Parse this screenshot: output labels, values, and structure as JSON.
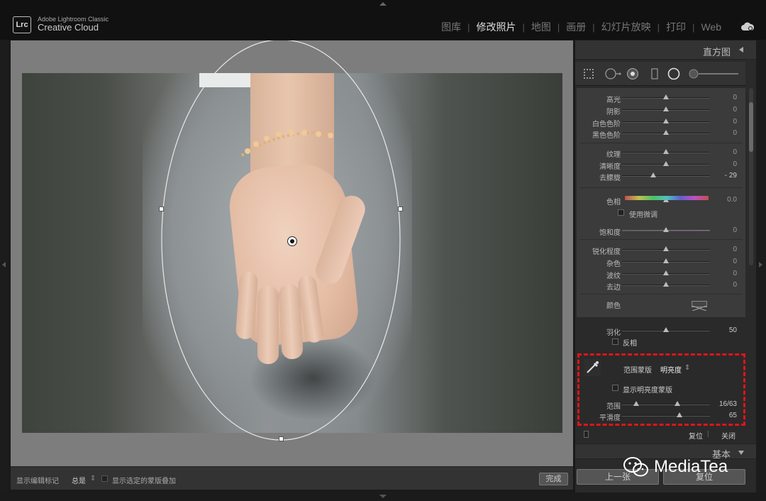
{
  "app": {
    "logo": "Lrc",
    "brand_line1": "Adobe Lightroom Classic",
    "brand_line2": "Creative Cloud"
  },
  "modules": [
    {
      "label": "图库",
      "active": false
    },
    {
      "label": "修改照片",
      "active": true
    },
    {
      "label": "地图",
      "active": false
    },
    {
      "label": "画册",
      "active": false
    },
    {
      "label": "幻灯片放映",
      "active": false
    },
    {
      "label": "打印",
      "active": false
    },
    {
      "label": "Web",
      "active": false
    }
  ],
  "toolbar": {
    "show_edit_pins_label": "显示编辑标记",
    "show_edit_pins_value": "总是",
    "show_overlay_label": "显示选定的蒙版叠加",
    "done_label": "完成"
  },
  "panel": {
    "histogram_title": "直方图",
    "basic_title": "基本",
    "prev_label": "上一张",
    "reset_label": "复位"
  },
  "sliders_group1": [
    {
      "label": "高光",
      "value": "0",
      "pos": 0.5
    },
    {
      "label": "阴影",
      "value": "0",
      "pos": 0.5
    },
    {
      "label": "白色色阶",
      "value": "0",
      "pos": 0.5
    },
    {
      "label": "黑色色阶",
      "value": "0",
      "pos": 0.5
    }
  ],
  "sliders_group2": [
    {
      "label": "纹理",
      "value": "0",
      "pos": 0.5
    },
    {
      "label": "清晰度",
      "value": "0",
      "pos": 0.5
    },
    {
      "label": "去朦胧",
      "value": "- 29",
      "pos": 0.355
    }
  ],
  "hue": {
    "label": "色相",
    "value": "0.0",
    "pos": 0.5
  },
  "fine_adjust_label": "使用微调",
  "saturation": {
    "label": "饱和度",
    "value": "0",
    "pos": 0.5
  },
  "sliders_group3": [
    {
      "label": "锐化程度",
      "value": "0",
      "pos": 0.5
    },
    {
      "label": "杂色",
      "value": "0",
      "pos": 0.5
    },
    {
      "label": "波纹",
      "value": "0",
      "pos": 0.5
    },
    {
      "label": "去边",
      "value": "0",
      "pos": 0.5
    }
  ],
  "color_label": "颜色",
  "feather": {
    "label": "羽化",
    "value": "50",
    "pos": 0.5
  },
  "invert_label": "反相",
  "range_mask": {
    "label": "范围蒙版",
    "mode": "明亮度",
    "show_mask_label": "显示明亮度蒙版",
    "range_label": "范围",
    "range_value": "16/63",
    "range_low": 0.16,
    "range_high": 0.63,
    "smooth_label": "平滑度",
    "smooth_value": "65",
    "smooth_pos": 0.65
  },
  "mask_footer": {
    "reset_label": "复位",
    "close_label": "关闭"
  },
  "watermark": "MediaTea"
}
